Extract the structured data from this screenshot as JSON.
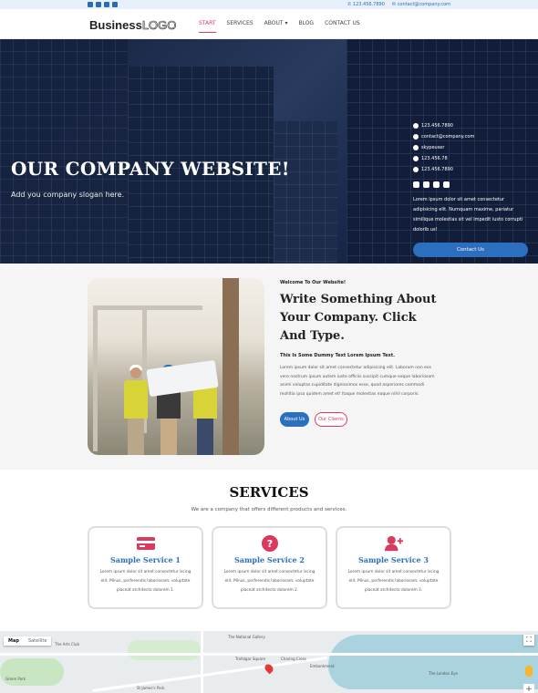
{
  "topbar": {
    "social": [
      "facebook-icon",
      "twitter-icon",
      "linkedin-icon",
      "youtube-icon"
    ],
    "phone": "123.456.7890",
    "email": "contact@company.com"
  },
  "nav": {
    "logo_strong": "Business",
    "logo_outline": "LOGO",
    "items": [
      {
        "label": "START",
        "active": true
      },
      {
        "label": "SERVICES",
        "active": false
      },
      {
        "label": "ABOUT",
        "active": false,
        "dropdown": true
      },
      {
        "label": "BLOG",
        "active": false
      },
      {
        "label": "CONTACT US",
        "active": false
      }
    ]
  },
  "hero": {
    "title": "OUR COMPANY WEBSITE!",
    "slogan": "Add you company slogan here.",
    "info": [
      {
        "icon": "phone-icon",
        "text": "123.456.7890"
      },
      {
        "icon": "email-icon",
        "text": "contact@company.com"
      },
      {
        "icon": "skype-icon",
        "text": "skypeuser"
      },
      {
        "icon": "whatsapp-icon",
        "text": "123.456.78"
      },
      {
        "icon": "fax-icon",
        "text": "123.456.7890"
      }
    ],
    "social": [
      "twitter-icon",
      "facebook-icon",
      "linkedin-icon",
      "youtube-icon"
    ],
    "text": "Lorem ipsum dolor sit amet consectetur adipisicing elit. Numquam maxime, pariatur similique molestias sit vel impedit iusto corrupti dolorib us!",
    "button": "Contact Us"
  },
  "about": {
    "eyebrow": "Welcome To Our Website!",
    "title": "Write Something About Your Company. Click And Type.",
    "subtitle": "This Is Some Dummy Text Lorem Ipsum Text.",
    "body": "Lorem ipsum dolor sit amet consectetur adipisicing elit. Laborum non eos vero nostrum ipsum autem iusto officiis suscipit cumque eaque laboriosam animi voluptas cupiditate dignissimos esse, quod asperiores commodi mollitia ipsa quidem amet et! Itaque molestias eaque nihil corporis.",
    "primary_button": "About Us",
    "secondary_button": "Our Clients"
  },
  "services": {
    "title": "SERVICES",
    "subtitle": "We are a company that offers different products and services.",
    "cards": [
      {
        "icon": "credit-card-icon",
        "title": "Sample Service 1",
        "body": "Lorem ipsum dolor sit amet consectetur iscing elit. Minus, perferendis laboriosam; voluptate placeat architecto dolorem 1."
      },
      {
        "icon": "question-circle-icon",
        "title": "Sample Service 2",
        "body": "Lorem ipsum dolor sit amet consectetur iscing elit. Minus, perferendis laboriosam; voluptate placeat architecto dolorem 2."
      },
      {
        "icon": "user-plus-icon",
        "title": "Sample Service 3",
        "body": "Lorem ipsum dolor sit amet consectetur iscing elit. Minus, perferendis laboriosam; voluptate placeat architecto dolorem 3."
      }
    ]
  },
  "map": {
    "type_map": "Map",
    "type_satellite": "Satellite",
    "labels": [
      "The National Gallery",
      "Trafalgar Square",
      "Charing Cross",
      "The Arts Club",
      "Green Park",
      "Embankment",
      "The London Eye",
      "St James's Park"
    ]
  },
  "colors": {
    "accent_pink": "#d93a5e",
    "primary_blue": "#2d6fbf",
    "hero_dark": "#1a2744"
  }
}
